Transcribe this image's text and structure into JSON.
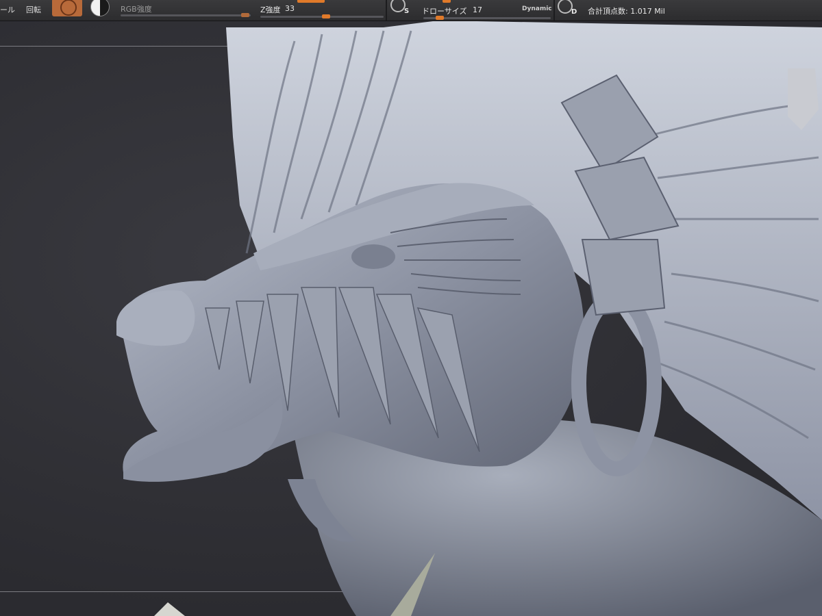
{
  "toolbar": {
    "left_cut_label": "ール",
    "rotate_label": "回転",
    "rgb_intensity_label": "RGB強度",
    "z_intensity_label": "Z強度",
    "z_intensity_value": "33",
    "s_label": "S",
    "draw_size_label": "ドローサイズ",
    "draw_size_value": "17",
    "dynamic_label": "Dynamic",
    "d_label": "D",
    "total_points_label": "合計頂点数: 1.017 Mil"
  },
  "colors": {
    "toolbar_bg": "#2c2c2e",
    "accent": "#e07a2a",
    "canvas_bg": "#2b2b30",
    "model_matcap": "#8d93a3"
  },
  "icons": {
    "material": "material-sphere-icon",
    "color_mode": "yin-yang-icon",
    "s_mode": "s-mode-icon",
    "d_mode": "d-mode-icon"
  }
}
